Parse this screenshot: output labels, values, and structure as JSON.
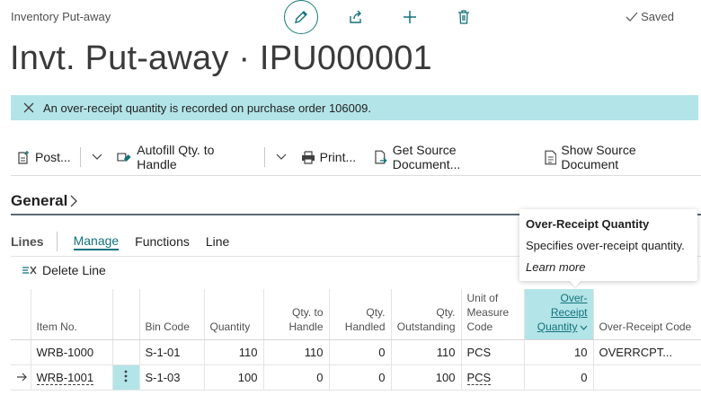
{
  "header": {
    "breadcrumb": "Inventory Put-away",
    "saved_label": "Saved",
    "title": "Invt. Put-away · IPU000001"
  },
  "notification": {
    "message": "An over-receipt quantity is recorded on purchase order 106009."
  },
  "actions": {
    "post": "Post...",
    "autofill": "Autofill Qty. to Handle",
    "print": "Print...",
    "get_source": "Get Source Document...",
    "show_source": "Show Source Document"
  },
  "general": {
    "label": "General"
  },
  "lines": {
    "caption": "Lines",
    "tabs": [
      "Manage",
      "Functions",
      "Line"
    ],
    "delete_line": "Delete Line"
  },
  "grid": {
    "columns": {
      "item_no": "Item No.",
      "bin_code": "Bin Code",
      "quantity": "Quantity",
      "qty_to_handle": "Qty. to Handle",
      "qty_handled": "Qty. Handled",
      "qty_outstanding": "Qty. Outstanding",
      "uom": "Unit of Measure Code",
      "over_receipt_qty": "Over-Receipt Quantity",
      "over_receipt_code": "Over-Receipt Code"
    },
    "rows": [
      {
        "item_no": "WRB-1000",
        "bin_code": "S-1-01",
        "quantity": "110",
        "qty_to_handle": "110",
        "qty_handled": "0",
        "qty_outstanding": "110",
        "uom": "PCS",
        "over_receipt_qty": "10",
        "over_receipt_code": "OVERRCPT..."
      },
      {
        "item_no": "WRB-1001",
        "bin_code": "S-1-03",
        "quantity": "100",
        "qty_to_handle": "0",
        "qty_handled": "0",
        "qty_outstanding": "100",
        "uom": "PCS",
        "over_receipt_qty": "0",
        "over_receipt_code": ""
      }
    ]
  },
  "tooltip": {
    "title": "Over-Receipt Quantity",
    "body": "Specifies over-receipt quantity.",
    "link": "Learn more"
  },
  "colors": {
    "accent": "#13727a",
    "highlight": "#b3e4e8"
  }
}
